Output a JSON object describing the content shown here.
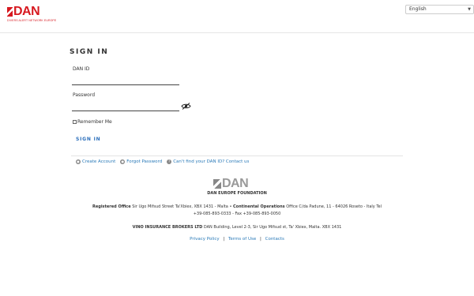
{
  "header": {
    "logo_text": "DAN",
    "logo_subtitle": "DIVERS ALERT NETWORK EUROPE",
    "language": {
      "selected": "English"
    }
  },
  "form": {
    "title": "SIGN IN",
    "dan_id_label": "DAN ID",
    "dan_id_value": "",
    "password_label": "Password",
    "password_value": "",
    "remember_label": "Remember Me",
    "submit_label": "SIGN IN"
  },
  "links": {
    "create_account": "Create Account",
    "forgot_password": "Forgot Password",
    "cant_find_id": "Can't find your DAN ID? Contact us"
  },
  "footer": {
    "logo_text": "DAN",
    "foundation": "DAN EUROPE FOUNDATION",
    "registered_label": "Registered Office",
    "registered_address": "Sir Ugo Mifsud Street Ta'Xbiex, XBX 1431 - Malta •",
    "continental_label": "Continental Operations",
    "continental_address": "Office C/da Padune, 11 - 64026 Roseto - Italy Tel",
    "phones": "+39-085-893-0333 - Fax +39-085-893-0050",
    "vino_label": "VINO INSURANCE BROKERS LTD",
    "vino_address": "DAN Building, Level 2-3, Sir Ugo Mifsud st, Ta' Xbiex, Malta. XBX 1431",
    "privacy": "Privacy Policy",
    "terms": "Terms of Use",
    "contacts": "Contacts",
    "separator": "|"
  }
}
